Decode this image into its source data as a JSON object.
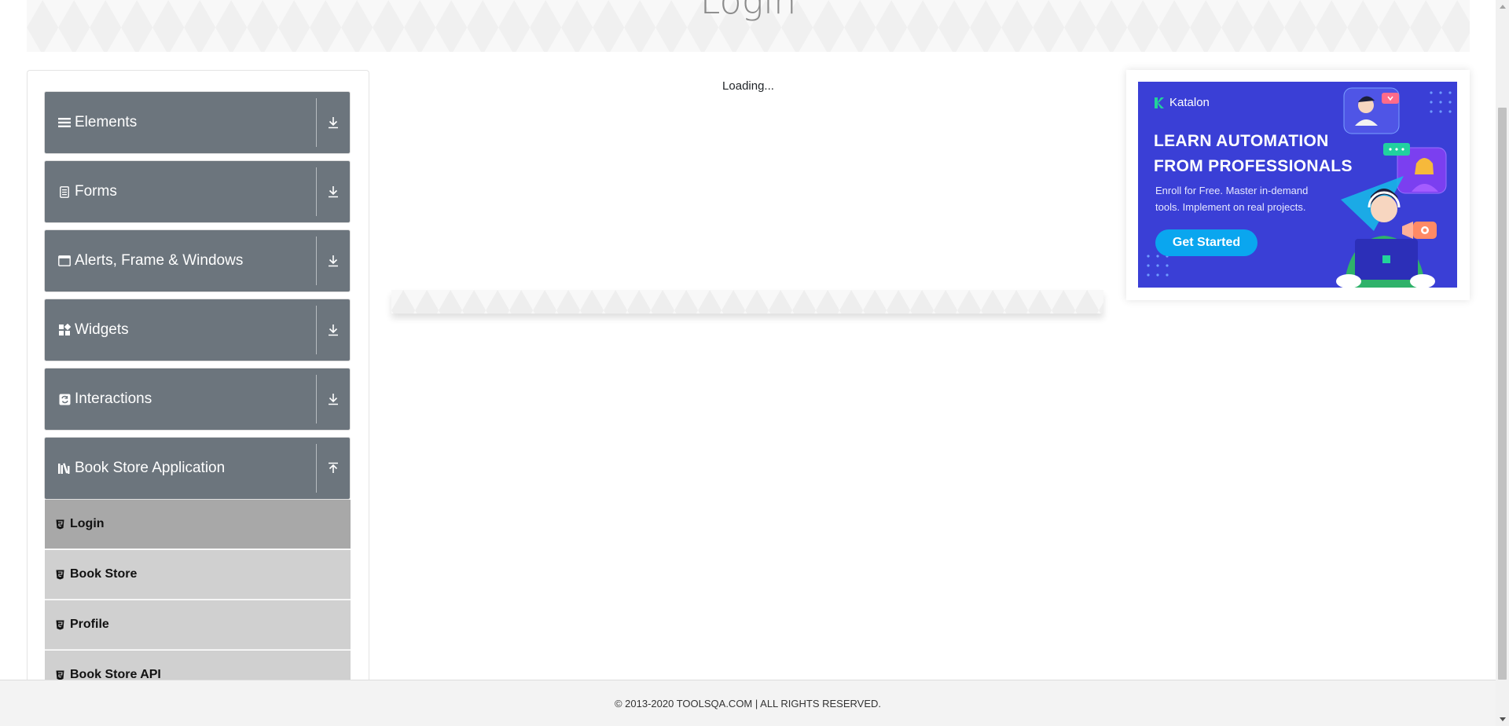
{
  "header": {
    "title": "Login"
  },
  "sidebar": {
    "groups": [
      {
        "label": "Elements",
        "icon": "menu-lines-icon",
        "arrow": "download-arrow-icon"
      },
      {
        "label": "Forms",
        "icon": "document-icon",
        "arrow": "download-arrow-icon"
      },
      {
        "label": "Alerts, Frame & Windows",
        "icon": "window-icon",
        "arrow": "download-arrow-icon"
      },
      {
        "label": "Widgets",
        "icon": "widgets-icon",
        "arrow": "download-arrow-icon"
      },
      {
        "label": "Interactions",
        "icon": "interactions-icon",
        "arrow": "download-arrow-icon"
      },
      {
        "label": "Book Store Application",
        "icon": "books-icon",
        "arrow": "upload-arrow-icon"
      }
    ],
    "book_store_items": [
      {
        "label": "Login",
        "active": true
      },
      {
        "label": "Book Store",
        "active": false
      },
      {
        "label": "Profile",
        "active": false
      },
      {
        "label": "Book Store API",
        "active": false
      }
    ]
  },
  "main": {
    "loading_text": "Loading..."
  },
  "ad": {
    "brand": "Katalon",
    "headline_line1": "LEARN AUTOMATION",
    "headline_line2": "FROM PROFESSIONALS",
    "sub_line1": "Enroll for Free. Master in-demand",
    "sub_line2": "tools. Implement on real projects.",
    "cta": "Get Started",
    "colors": {
      "background": "#3a3fd6",
      "cta": "#0aa6ef"
    }
  },
  "footer": {
    "text": "© 2013-2020 TOOLSQA.COM | ALL RIGHTS RESERVED."
  },
  "colors": {
    "group_bg": "#6c757d",
    "sub_item_bg": "#d0d0d0",
    "sub_item_active_bg": "#a8a8a8"
  }
}
